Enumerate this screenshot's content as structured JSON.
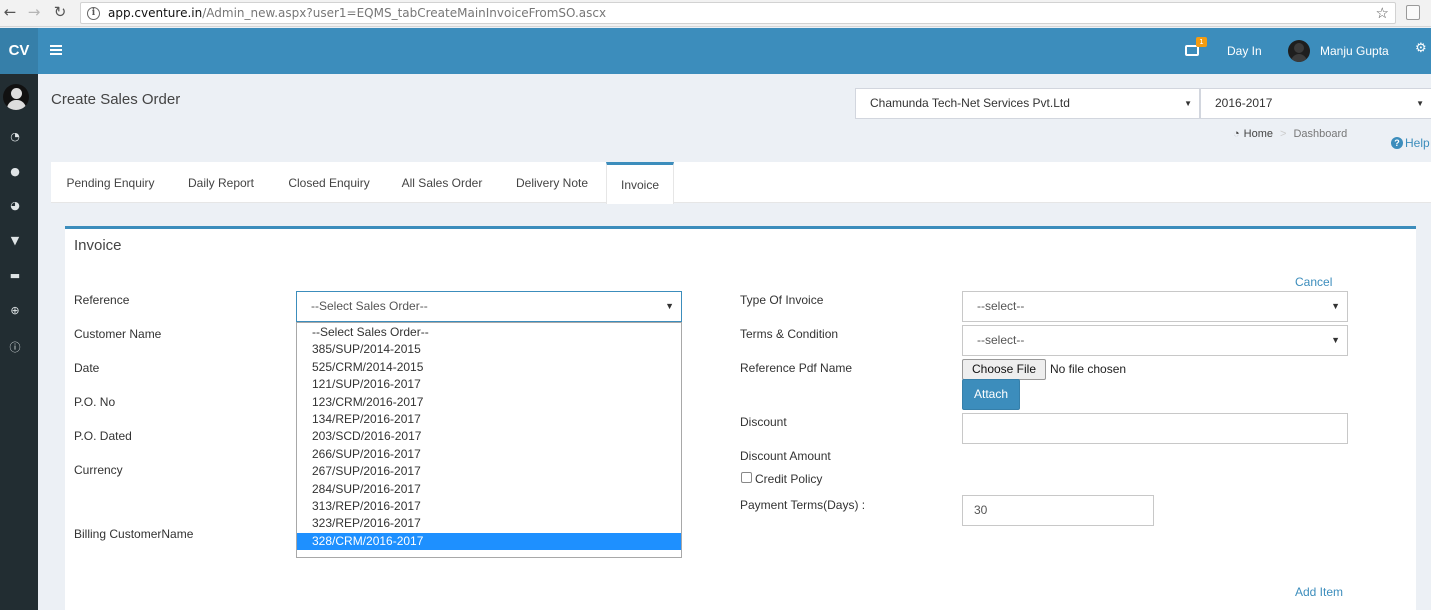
{
  "browser": {
    "url_host": "app.cventure.in",
    "url_path": "/Admin_new.aspx?user1=EQMS_tabCreateMainInvoiceFromSO.ascx"
  },
  "header": {
    "logo": "CV",
    "notification_count": "1",
    "day_in": "Day In",
    "user_name": "Manju Gupta"
  },
  "page": {
    "title": "Create Sales Order",
    "company_select": "Chamunda Tech-Net Services Pvt.Ltd",
    "year_select": "2016-2017",
    "breadcrumb": {
      "home": "Home",
      "current": "Dashboard"
    },
    "help": "Help"
  },
  "tabs": [
    "Pending Enquiry",
    "Daily Report",
    "Closed Enquiry",
    "All Sales Order",
    "Delivery Note",
    "Invoice"
  ],
  "form": {
    "title": "Invoice",
    "cancel": "Cancel",
    "add_item": "Add Item",
    "left_labels": {
      "reference": "Reference",
      "customer_name": "Customer Name",
      "date": "Date",
      "po_no": "P.O. No",
      "po_dated": "P.O. Dated",
      "currency": "Currency",
      "billing_customer_name": "Billing CustomerName"
    },
    "reference_select": "--Select Sales Order--",
    "reference_options": [
      "--Select Sales Order--",
      "385/SUP/2014-2015",
      "525/CRM/2014-2015",
      "121/SUP/2016-2017",
      "123/CRM/2016-2017",
      "134/REP/2016-2017",
      "203/SCD/2016-2017",
      "266/SUP/2016-2017",
      "267/SUP/2016-2017",
      "284/SUP/2016-2017",
      "313/REP/2016-2017",
      "323/REP/2016-2017",
      "328/CRM/2016-2017"
    ],
    "highlighted_option": "328/CRM/2016-2017",
    "right_labels": {
      "type_of_invoice": "Type Of Invoice",
      "terms_condition": "Terms & Condition",
      "reference_pdf": "Reference Pdf Name",
      "discount": "Discount",
      "discount_amount": "Discount Amount",
      "credit_policy": "Credit Policy",
      "payment_terms": "Payment Terms(Days) :"
    },
    "type_of_invoice_select": "--select--",
    "terms_select": "--select--",
    "choose_file": "Choose File",
    "no_file": "No file chosen",
    "attach": "Attach",
    "discount_value": "",
    "payment_terms_value": "30"
  }
}
